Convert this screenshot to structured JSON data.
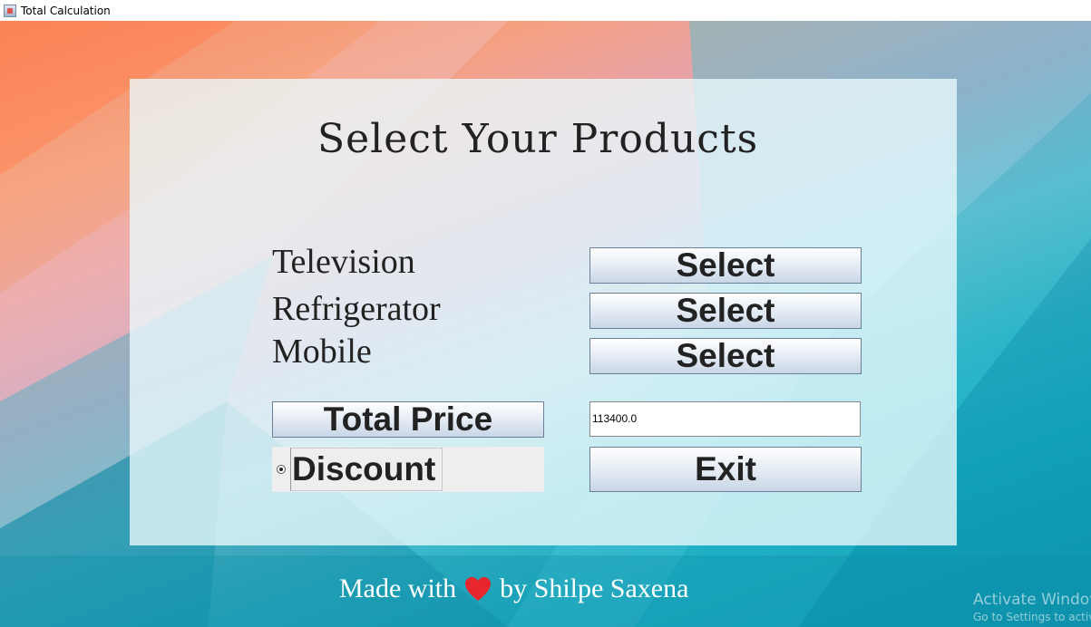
{
  "window": {
    "title": "Total Calculation"
  },
  "heading": "Select Your Products",
  "products": [
    {
      "label": "Television",
      "button": "Select"
    },
    {
      "label": "Refrigerator",
      "button": "Select"
    },
    {
      "label": "Mobile",
      "button": "Select"
    }
  ],
  "total": {
    "button": "Total Price",
    "value": "113400.0"
  },
  "discount": {
    "label": "Discount",
    "selected": true
  },
  "exit": {
    "label": "Exit"
  },
  "footer": {
    "prefix": "Made with",
    "suffix": "by Shilpe Saxena",
    "heart_color": "#e8262e"
  },
  "watermark": {
    "title": "Activate Windows",
    "subtitle": "Go to Settings to activate Windows."
  }
}
